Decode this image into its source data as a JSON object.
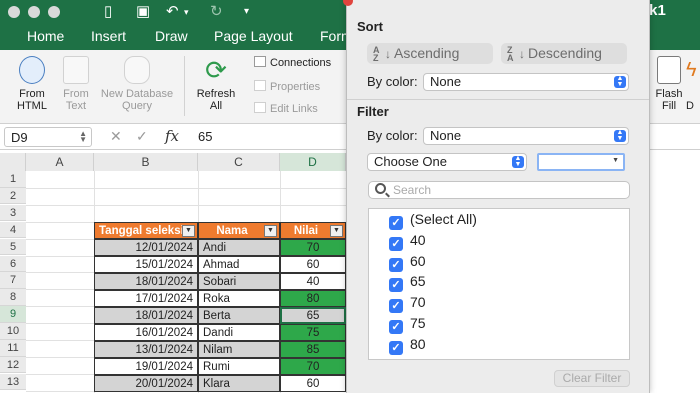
{
  "window": {
    "title_fragment": "ok1"
  },
  "ribbon_tabs": [
    "Home",
    "Insert",
    "Draw",
    "Page Layout",
    "Form"
  ],
  "ribbon": {
    "from_html": [
      "From",
      "HTML"
    ],
    "from_text": [
      "From",
      "Text"
    ],
    "new_db_query": [
      "New Database",
      "Query"
    ],
    "refresh_all": [
      "Refresh",
      "All"
    ],
    "connections": "Connections",
    "properties": "Properties",
    "edit_links": "Edit Links",
    "flash_fill": [
      "Flash",
      "Fill"
    ],
    "cut_label": "D"
  },
  "formula_bar": {
    "name_box": "D9",
    "fx": "fx",
    "value": "65"
  },
  "columns": [
    "A",
    "B",
    "C",
    "D"
  ],
  "rows": [
    "1",
    "2",
    "3",
    "4",
    "5",
    "6",
    "7",
    "8",
    "9",
    "10",
    "11",
    "12",
    "13"
  ],
  "table": {
    "headers": [
      "Tanggal seleksi",
      "Nama",
      "Nilai"
    ],
    "rows": [
      {
        "date": "12/01/2024",
        "name": "Andi",
        "score": "70"
      },
      {
        "date": "15/01/2024",
        "name": "Ahmad",
        "score": "60"
      },
      {
        "date": "18/01/2024",
        "name": "Sobari",
        "score": "40"
      },
      {
        "date": "17/01/2024",
        "name": "Roka",
        "score": "80"
      },
      {
        "date": "18/01/2024",
        "name": "Berta",
        "score": "65"
      },
      {
        "date": "16/01/2024",
        "name": "Dandi",
        "score": "75"
      },
      {
        "date": "13/01/2024",
        "name": "Nilam",
        "score": "85"
      },
      {
        "date": "19/01/2024",
        "name": "Rumi",
        "score": "70"
      },
      {
        "date": "20/01/2024",
        "name": "Klara",
        "score": "60"
      }
    ]
  },
  "filter_panel": {
    "sort_heading": "Sort",
    "ascending": "Ascending",
    "descending": "Descending",
    "by_color_label": "By color:",
    "sort_color_value": "None",
    "filter_heading": "Filter",
    "filter_color_value": "None",
    "choose_one": "Choose One",
    "search_placeholder": "Search",
    "items": [
      "(Select All)",
      "40",
      "60",
      "65",
      "70",
      "75",
      "80",
      "85"
    ],
    "clear_filter": "Clear Filter",
    "checkmark": "✓"
  },
  "colors": {
    "excel_green": "#1e7145",
    "header_orange": "#ef7b2f",
    "cell_green": "#2ea84a",
    "cell_gray": "#d4d4d4",
    "mac_blue": "#3478f6"
  }
}
